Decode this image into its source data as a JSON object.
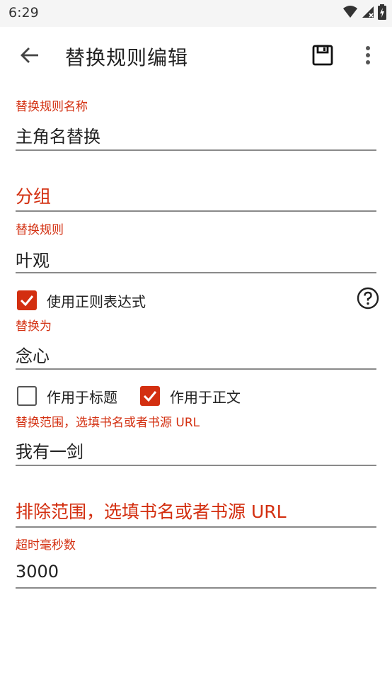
{
  "status_bar": {
    "time": "6:29"
  },
  "app_bar": {
    "title": "替换规则编辑"
  },
  "fields": {
    "rule_name": {
      "label": "替换规则名称",
      "value": "主角名替换"
    },
    "group": {
      "placeholder": "分组"
    },
    "pattern": {
      "label": "替换规则",
      "value": "叶观"
    },
    "replacement": {
      "label": "替换为",
      "value": "念心"
    },
    "scope": {
      "label": "替换范围，选填书名或者书源 URL",
      "value": "我有一剑"
    },
    "exclude_scope": {
      "placeholder": "排除范围，选填书名或者书源 URL"
    },
    "timeout": {
      "label": "超时毫秒数",
      "value": "3000"
    }
  },
  "checkboxes": {
    "use_regex": {
      "label": "使用正则表达式",
      "checked": true
    },
    "apply_title": {
      "label": "作用于标题",
      "checked": false
    },
    "apply_content": {
      "label": "作用于正文",
      "checked": true
    }
  },
  "icons": {
    "back": "arrow-left-icon",
    "save": "save-icon",
    "more": "more-vert-icon",
    "help": "help-circle-icon",
    "wifi": "wifi-icon",
    "signal": "signal-icon",
    "battery": "battery-icon"
  },
  "colors": {
    "accent": "#d32f10",
    "text": "#212121",
    "underline": "#8a8a8a"
  }
}
